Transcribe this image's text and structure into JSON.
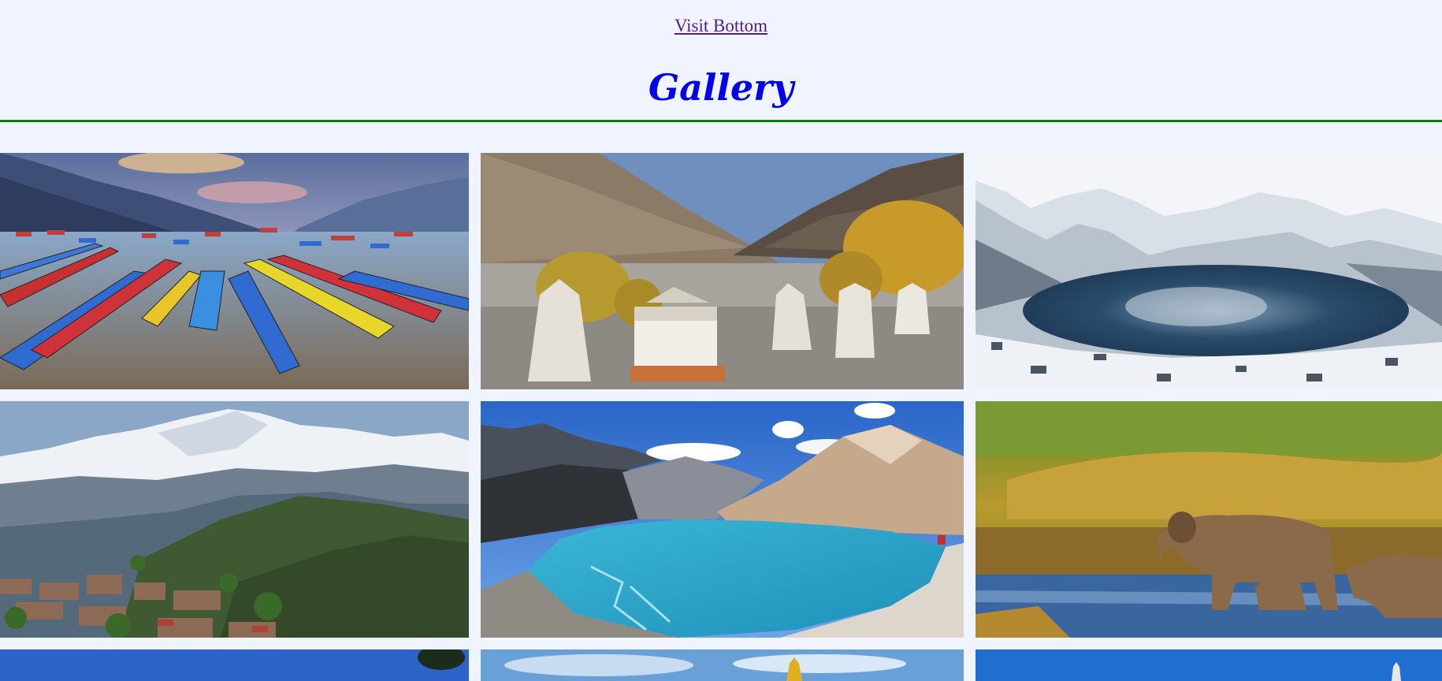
{
  "nav": {
    "visit_bottom_label": "Visit Bottom"
  },
  "page": {
    "title": "Gallery"
  },
  "gallery": {
    "images": [
      {
        "subject": "colorful-boats-lake"
      },
      {
        "subject": "stupas-mountain-valley"
      },
      {
        "subject": "frozen-lake-snow"
      },
      {
        "subject": "himalaya-village"
      },
      {
        "subject": "turquoise-glacier-lake"
      },
      {
        "subject": "elephants-river"
      },
      {
        "subject": "blue-sky-tree"
      },
      {
        "subject": "stupa-spire-sky"
      },
      {
        "subject": "blue-sky-spire"
      }
    ]
  },
  "colors": {
    "link": "#551a8b",
    "title": "#0000ee",
    "rule": "#0a7d0a",
    "background": "#f0f4fe"
  }
}
